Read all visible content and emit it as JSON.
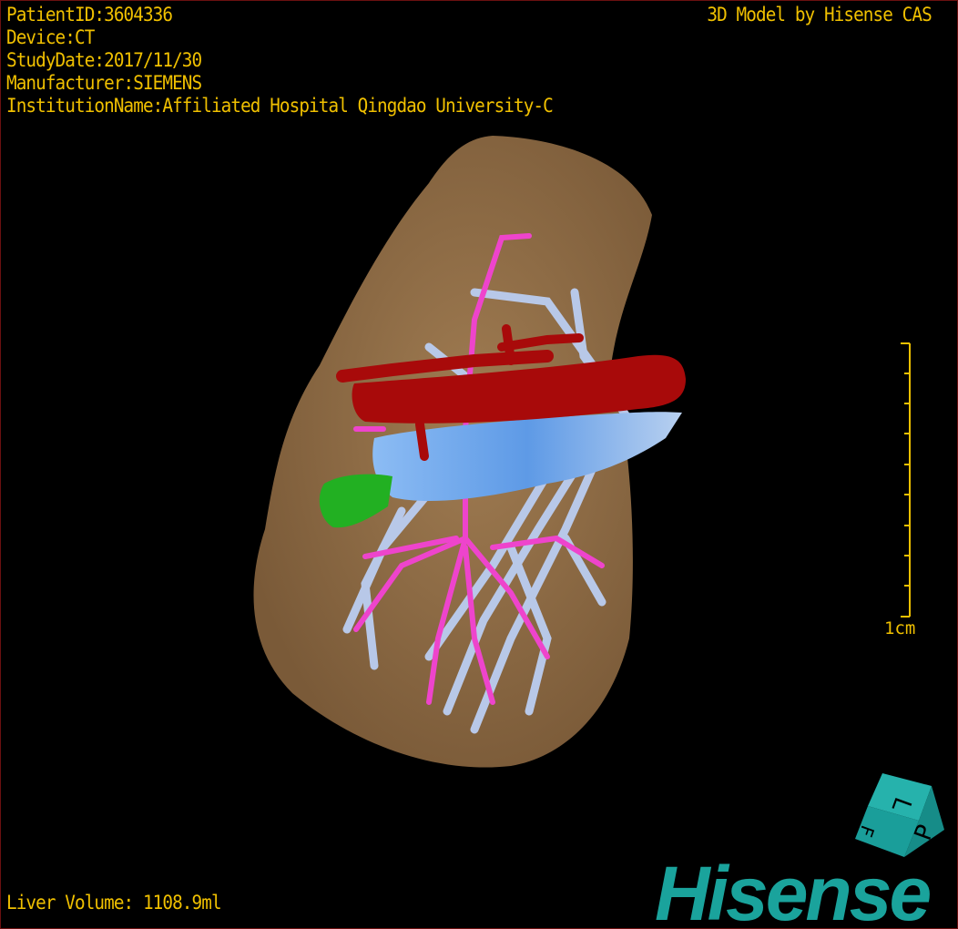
{
  "overlay": {
    "patient_id": "PatientID:3604336",
    "device": "Device:CT",
    "study_date": "StudyDate:2017/11/30",
    "manufacturer": "Manufacturer:SIEMENS",
    "institution": "InstitutionName:Affiliated Hospital Qingdao University-C",
    "credit": "3D Model by Hisense CAS",
    "liver_volume": "Liver Volume: 1108.9ml"
  },
  "scale_bar": {
    "label": "1cm"
  },
  "orientation_cube": {
    "faces": [
      "L",
      "P",
      "F"
    ],
    "color": "#1a9e9a"
  },
  "logo": {
    "text": "Hisense",
    "color": "#1aa39c"
  },
  "colors": {
    "liver": "#8c6a45",
    "artery": "#a80a0a",
    "portal_vein": "#ee44cc",
    "hepatic_vein": "#b8c8e8",
    "vena_cava": "#6ea8ee",
    "gallbladder": "#22b022",
    "text": "#f0c000"
  }
}
